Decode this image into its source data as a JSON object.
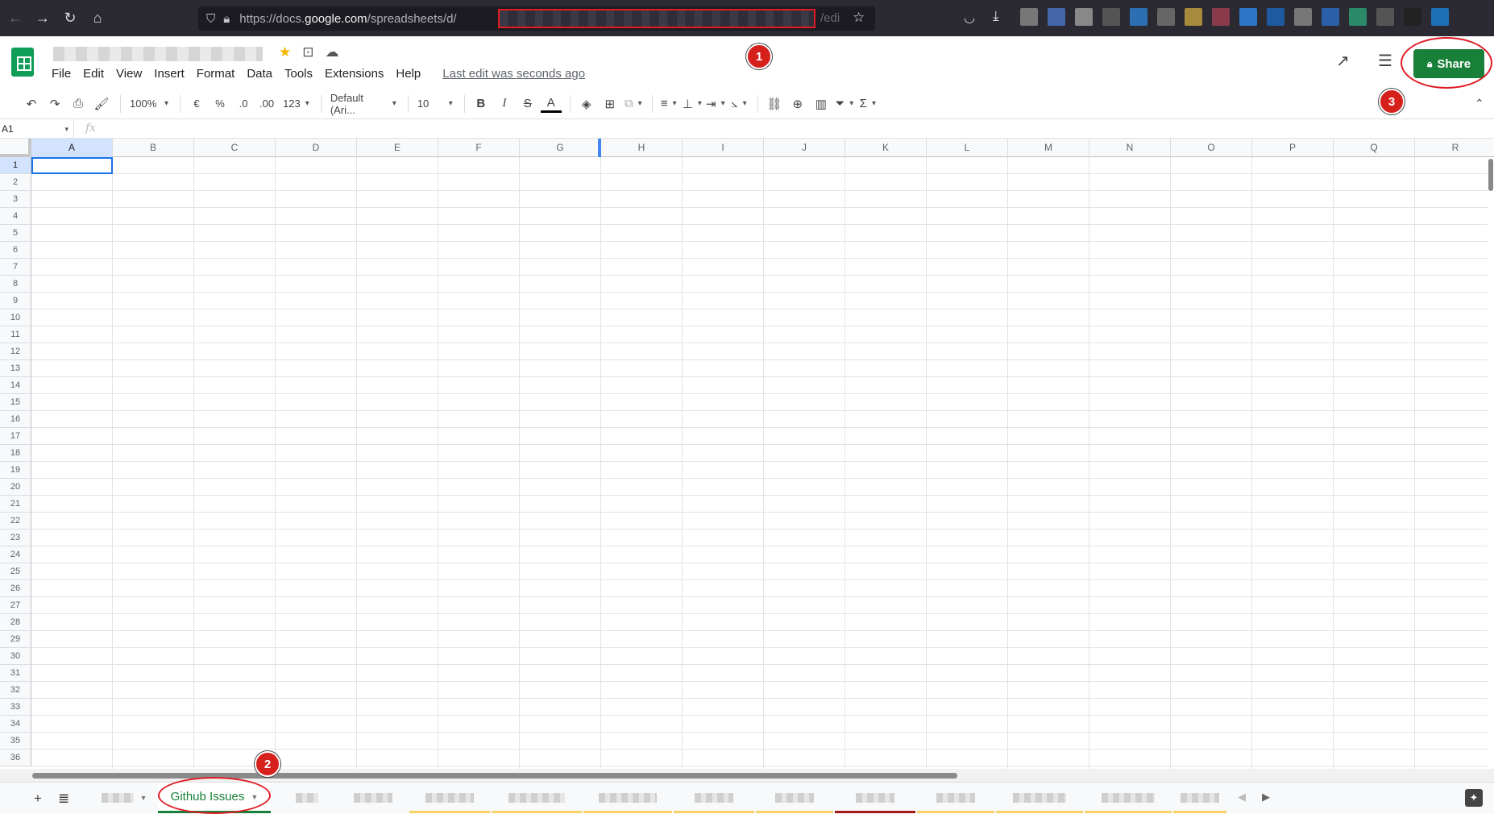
{
  "browser": {
    "url_prefix": "https://docs.",
    "url_domain": "google.com",
    "url_path": "/spreadsheets/d/",
    "url_suffix": "/edi"
  },
  "header": {
    "menu": [
      "File",
      "Edit",
      "View",
      "Insert",
      "Format",
      "Data",
      "Tools",
      "Extensions",
      "Help"
    ],
    "last_edit": "Last edit was seconds ago",
    "share_label": "Share"
  },
  "toolbar": {
    "zoom": "100%",
    "currency": "€",
    "percent": "%",
    "dec_decrease": ".0",
    "dec_increase": ".00",
    "number_format": "123",
    "font": "Default (Ari...",
    "font_size": "10"
  },
  "formula": {
    "cell_ref": "A1",
    "fx": "fx"
  },
  "grid": {
    "columns": [
      "A",
      "B",
      "C",
      "D",
      "E",
      "F",
      "G",
      "H",
      "I",
      "J",
      "K",
      "L",
      "M",
      "N",
      "O",
      "P",
      "Q",
      "R"
    ],
    "rows": [
      "1",
      "2",
      "3",
      "4",
      "5",
      "6",
      "7",
      "8",
      "9",
      "10",
      "11",
      "12",
      "13",
      "14",
      "15",
      "16",
      "17",
      "18",
      "19",
      "20",
      "21",
      "22",
      "23",
      "24",
      "25",
      "26",
      "27",
      "28",
      "29",
      "30",
      "31",
      "32",
      "33",
      "34",
      "35",
      "36"
    ],
    "selected_cell": "A1"
  },
  "tabs": {
    "active_label": "Github Issues"
  },
  "annotations": {
    "badge_1": "1",
    "badge_2": "2",
    "badge_3": "3"
  },
  "colors": {
    "share_green": "#188038",
    "annotation_red": "#d6201c",
    "selection_blue": "#1a73e8"
  }
}
